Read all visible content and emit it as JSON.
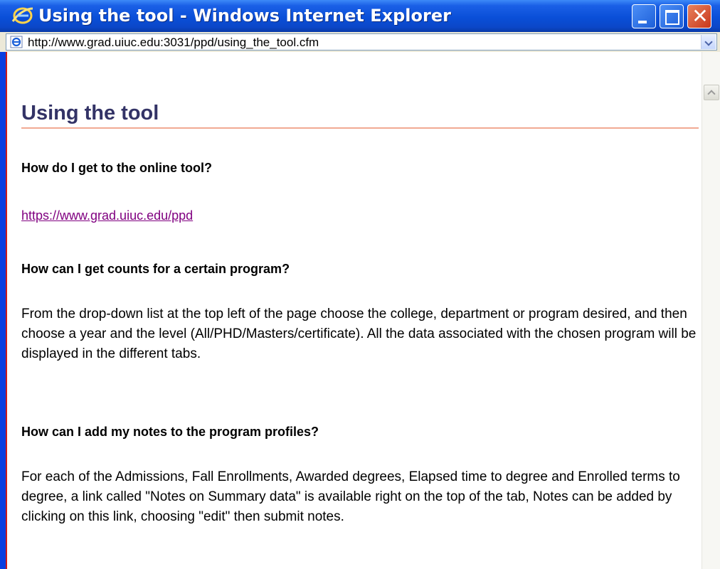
{
  "window": {
    "title": "Using the tool - Windows Internet Explorer",
    "address": "http://www.grad.uiuc.edu:3031/ppd/using_the_tool.cfm"
  },
  "page": {
    "heading": "Using the tool",
    "q1": "How do I get to the online tool?",
    "link": "https://www.grad.uiuc.edu/ppd",
    "q2": "How can I get counts for a certain program?",
    "a2": "From the drop-down list at the top left of the page choose the college, department or program desired, and then choose a year and the level (All/PHD/Masters/certificate). All the data associated with the chosen program will be displayed in the different tabs.",
    "q3": "How can I add my notes to the program profiles?",
    "a3": "For each of the Admissions, Fall Enrollments, Awarded degrees, Elapsed time to degree and Enrolled terms to degree, a link called \"Notes on Summary data\" is available right on the top of the tab, Notes can be added by clicking on this link, choosing \"edit\" then submit notes."
  },
  "colors": {
    "titlebar": "#0a4fd8",
    "heading": "#333366",
    "visited_link": "#800080",
    "heading_rule": "#f1a993",
    "frame_edge": "#cc1a1a"
  },
  "icons": [
    "ie-logo-icon",
    "page-ie-icon",
    "minimize-icon",
    "maximize-icon",
    "close-icon",
    "dropdown-arrow-icon",
    "scroll-up-arrow-icon"
  ]
}
